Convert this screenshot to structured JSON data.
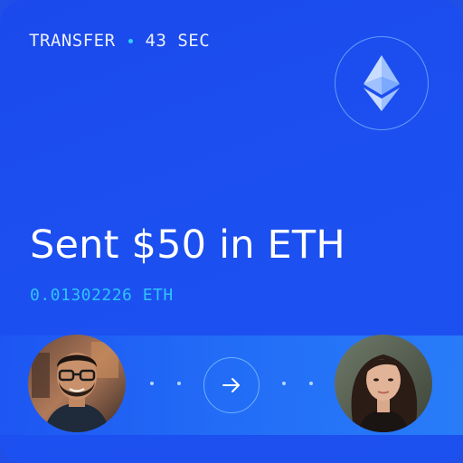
{
  "header": {
    "label": "TRANSFER",
    "elapsed": "43 SEC"
  },
  "asset": {
    "icon": "ethereum-icon"
  },
  "transfer": {
    "title": "Sent $50 in ETH",
    "crypto_amount": "0.01302226 ETH"
  },
  "participants": {
    "sender_icon": "sender-avatar",
    "recipient_icon": "recipient-avatar",
    "direction_icon": "arrow-right-icon"
  },
  "colors": {
    "background": "#1c4ff0",
    "accent": "#2fc4ff",
    "text": "#ffffff"
  }
}
